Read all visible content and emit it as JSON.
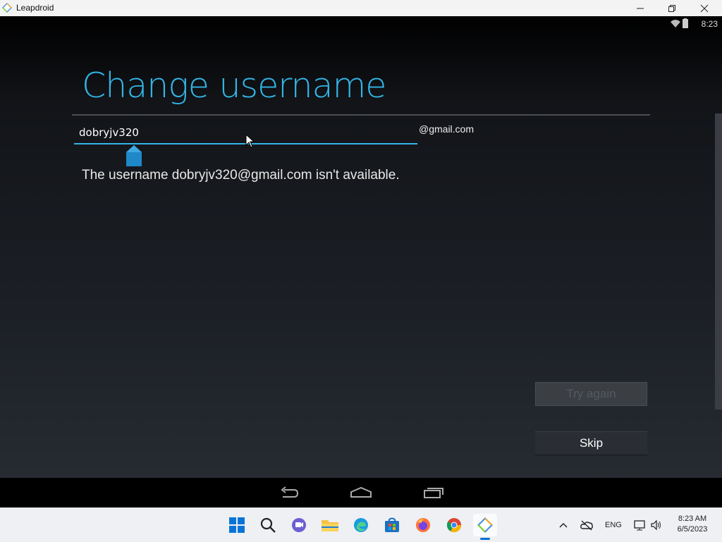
{
  "window": {
    "title": "Leapdroid"
  },
  "android": {
    "status": {
      "time": "8:23"
    },
    "heading": "Change username",
    "username_value": "dobryjv320",
    "domain_suffix": "@gmail.com",
    "message": "The username dobryjv320@gmail.com isn't available.",
    "try_again_label": "Try again",
    "skip_label": "Skip"
  },
  "taskbar": {
    "language": "ENG",
    "time": "8:23 AM",
    "date": "6/5/2023"
  },
  "colors": {
    "accent": "#33b5e5",
    "titlebar": "#f3f3f3",
    "taskbar": "#eef0f3"
  }
}
